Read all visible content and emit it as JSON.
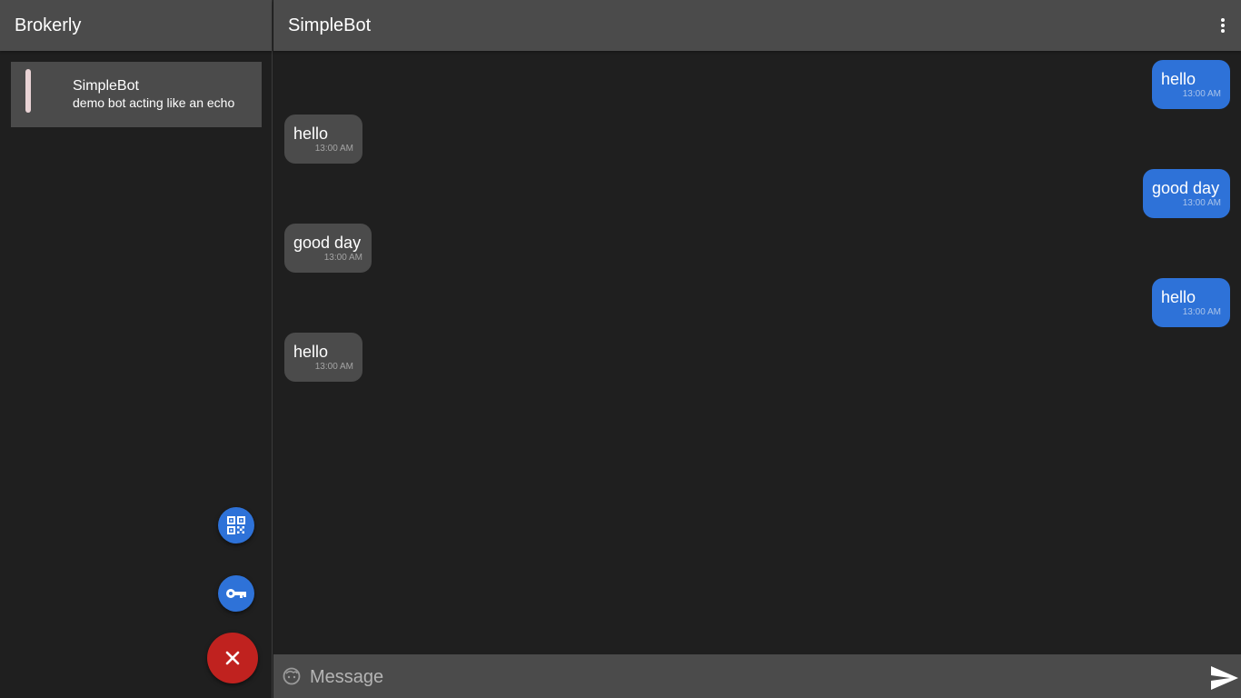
{
  "sidebar": {
    "title": "Brokerly",
    "chats": [
      {
        "name": "SimpleBot",
        "description": "demo bot acting like an echo"
      }
    ]
  },
  "chat": {
    "title": "SimpleBot",
    "messages": [
      {
        "direction": "out",
        "text": "hello",
        "time": "13:00 AM"
      },
      {
        "direction": "in",
        "text": "hello",
        "time": "13:00 AM"
      },
      {
        "direction": "out",
        "text": "good day",
        "time": "13:00 AM"
      },
      {
        "direction": "in",
        "text": "good day",
        "time": "13:00 AM"
      },
      {
        "direction": "out",
        "text": "hello",
        "time": "13:00 AM"
      },
      {
        "direction": "in",
        "text": "hello",
        "time": "13:00 AM"
      }
    ]
  },
  "composer": {
    "placeholder": "Message",
    "value": ""
  },
  "icons": {
    "qr": "qr-code-icon",
    "key": "key-icon",
    "close": "close-icon",
    "menu": "more-vert-icon",
    "emoji": "emoji-icon",
    "send": "send-icon"
  },
  "colors": {
    "header": "#4b4b4b",
    "background": "#1f1f1f",
    "outgoing_bubble": "#2e72d8",
    "incoming_bubble": "#4b4b4b",
    "close_fab": "#c0221f",
    "fab": "#2e72d8"
  }
}
